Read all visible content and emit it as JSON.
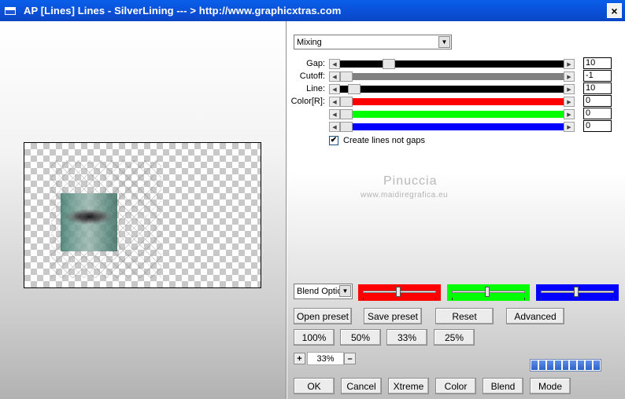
{
  "window": {
    "title": "AP [Lines]  Lines - SilverLining     --- > http://www.graphicxtras.com",
    "close_label": "×"
  },
  "mode_select": {
    "value": "Mixing",
    "arrow": "▼"
  },
  "params": {
    "gap": {
      "label": "Gap:",
      "value": "10"
    },
    "cutoff": {
      "label": "Cutoff:",
      "value": "-1"
    },
    "line": {
      "label": "Line:",
      "value": "10"
    },
    "color_r": {
      "label": "Color[R]:",
      "value": "0"
    },
    "color_g": {
      "value": "0"
    },
    "color_b": {
      "value": "0"
    }
  },
  "colors": {
    "red": "#ff0000",
    "green": "#00ff00",
    "blue": "#0000ff",
    "black": "#000000",
    "gray": "#808080"
  },
  "checkbox": {
    "label": "Create lines not gaps",
    "checked_mark": "✔"
  },
  "watermark": {
    "title": "Pinuccia",
    "url": "www.maidiregrafica.eu"
  },
  "blend_select": {
    "value": "Blend Options",
    "arrow": "▼"
  },
  "buttons": {
    "open_preset": "Open preset",
    "save_preset": "Save preset",
    "reset": "Reset",
    "advanced": "Advanced",
    "z100": "100%",
    "z50": "50%",
    "z33": "33%",
    "z25": "25%",
    "ok": "OK",
    "cancel": "Cancel",
    "xtreme": "Xtreme",
    "color": "Color",
    "blend": "Blend",
    "mode": "Mode"
  },
  "zoom": {
    "plus": "+",
    "minus": "–",
    "value": "33%"
  },
  "progress": {
    "fraction": 1.0
  }
}
